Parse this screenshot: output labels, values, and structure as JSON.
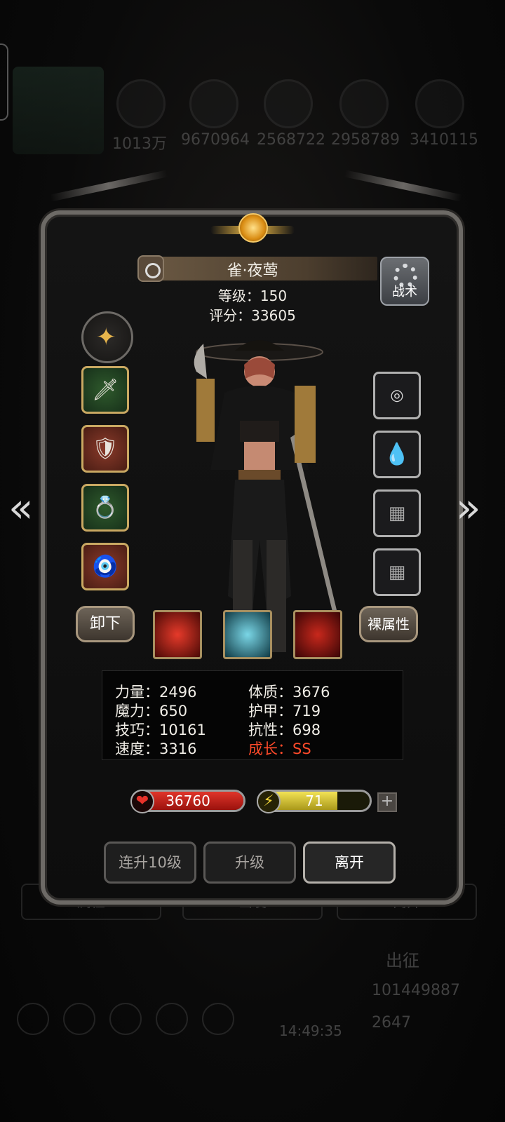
{
  "background": {
    "resources": [
      "1013万",
      "9670964",
      "2568722",
      "2958789",
      "3410115"
    ],
    "tabs": [
      "属性",
      "出发",
      "离开"
    ],
    "depart_label": "出征",
    "gold": "101449887",
    "gems": "2647",
    "time": "14:49:35"
  },
  "hero": {
    "name": "雀·夜莺",
    "level": "等级：150",
    "score": "评分：33605",
    "tactics_label": "战术"
  },
  "equipment": {
    "left": [
      "weapon-dagger-icon",
      "armor-icon",
      "ring-icon",
      "amulet-icon"
    ],
    "right": [
      "belt-icon",
      "water-gem-icon",
      "empty-slot-icon",
      "empty-slot-icon"
    ]
  },
  "buttons": {
    "unequip": "卸下",
    "base_attr": "裸属性",
    "level10": "连升10级",
    "upgrade": "升级",
    "leave": "离开"
  },
  "stats": {
    "strength": "力量：2496",
    "magic": "魔力：650",
    "skill": "技巧：10161",
    "speed": "速度：3316",
    "constitution": "体质：3676",
    "armor": "护甲：719",
    "resistance": "抗性：698",
    "growth": "成长：SS"
  },
  "bars": {
    "hp": "36760",
    "hp_fill": 1.0,
    "energy": "71",
    "energy_fill": 0.71
  },
  "colors": {
    "growth": "#ff4a2a",
    "hp": "#e0352a",
    "energy": "#f2e255",
    "gold_accent": "#e7b54c"
  }
}
